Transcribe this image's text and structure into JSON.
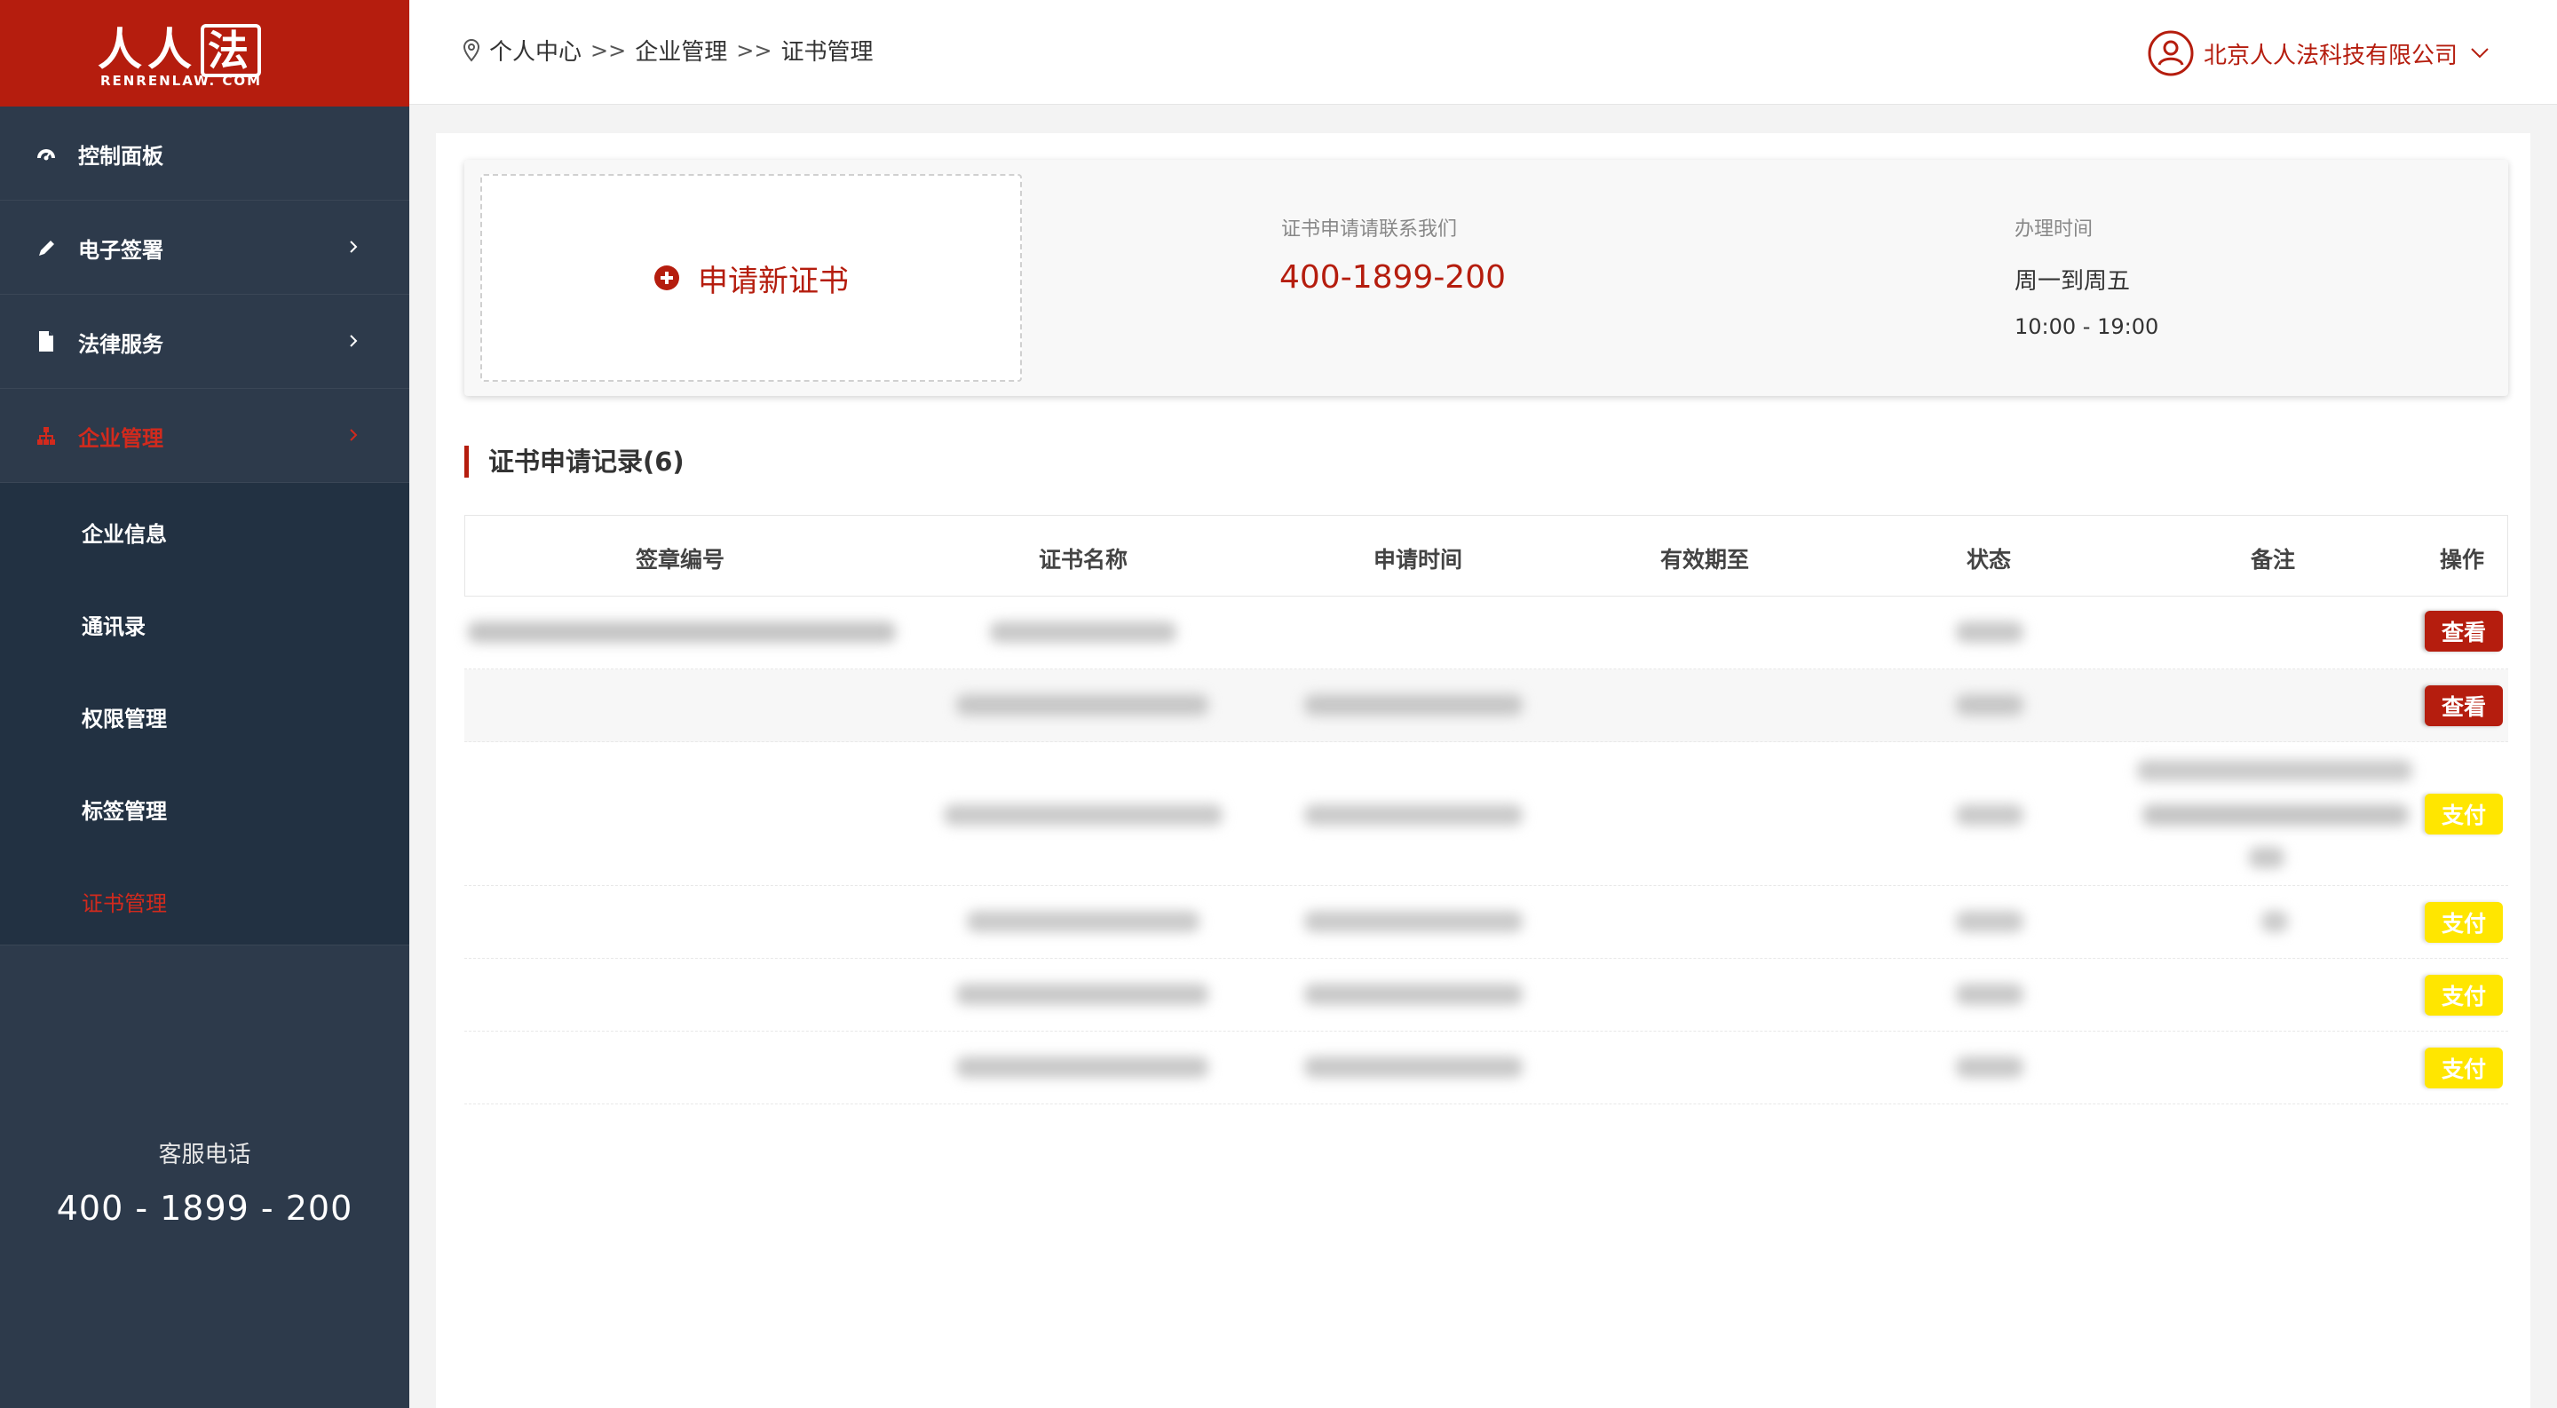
{
  "logo": {
    "main_text": "人人",
    "main_box_text": "法",
    "sub_text": "RENRENLAW. COM"
  },
  "sidebar": {
    "items": [
      {
        "label": "控制面板",
        "icon": "dashboard-icon",
        "has_chevron": false,
        "active": false
      },
      {
        "label": "电子签署",
        "icon": "pencil-icon",
        "has_chevron": true,
        "active": false
      },
      {
        "label": "法律服务",
        "icon": "document-icon",
        "has_chevron": true,
        "active": false
      },
      {
        "label": "企业管理",
        "icon": "org-chart-icon",
        "has_chevron": true,
        "active": true
      }
    ],
    "submenu": [
      {
        "label": "企业信息",
        "active": false
      },
      {
        "label": "通讯录",
        "active": false
      },
      {
        "label": "权限管理",
        "active": false
      },
      {
        "label": "标签管理",
        "active": false
      },
      {
        "label": "证书管理",
        "active": true
      }
    ],
    "service_label": "客服电话",
    "service_phone": "400 - 1899 - 200"
  },
  "header": {
    "breadcrumb": [
      "个人中心",
      "企业管理",
      "证书管理"
    ],
    "breadcrumb_sep": ">>",
    "company_name": "北京人人法科技有限公司"
  },
  "top_card": {
    "apply_label": "申请新证书",
    "contact_label": "证书申请请联系我们",
    "contact_phone": "400-1899-200",
    "hours_label": "办理时间",
    "hours_days": "周一到周五",
    "hours_time": "10:00 - 19:00"
  },
  "records": {
    "title": "证书申请记录(6)",
    "columns": [
      "签章编号",
      "证书名称",
      "申请时间",
      "有效期至",
      "状态",
      "备注",
      "操作"
    ],
    "rows": [
      {
        "action": "查看",
        "action_type": "view"
      },
      {
        "action": "查看",
        "action_type": "view"
      },
      {
        "action": "支付",
        "action_type": "pay"
      },
      {
        "action": "支付",
        "action_type": "pay"
      },
      {
        "action": "支付",
        "action_type": "pay"
      },
      {
        "action": "支付",
        "action_type": "pay"
      }
    ]
  },
  "colors": {
    "brand_red": "#b51d0e",
    "sidebar_bg": "#2d3a4b",
    "submenu_bg": "#223142",
    "pay_yellow": "#ffe600"
  }
}
